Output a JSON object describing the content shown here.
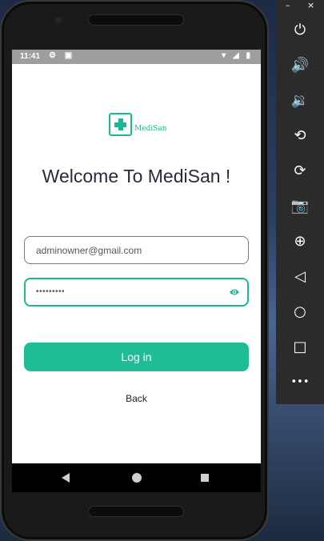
{
  "status_bar": {
    "time": "11:41",
    "left_icons": "⚙ ▣",
    "right_icons": "▾ ◢ ▮"
  },
  "logo": {
    "text": "MediSan",
    "color": "#1ab994"
  },
  "welcome": "Welcome To MediSan !",
  "email": {
    "value": "adminowner@gmail.com"
  },
  "password": {
    "masked_value": "•••••••••"
  },
  "login_button": {
    "label": "Log in",
    "color": "#1ebd96"
  },
  "back_link": "Back",
  "emulator_toolbar": {
    "window_controls": [
      "–",
      "×"
    ],
    "buttons": [
      {
        "name": "power-icon",
        "glyph": "⏻"
      },
      {
        "name": "volume-up-icon",
        "glyph": "🔊"
      },
      {
        "name": "volume-down-icon",
        "glyph": "🔉"
      },
      {
        "name": "rotate-left-icon",
        "glyph": "⟲"
      },
      {
        "name": "rotate-right-icon",
        "glyph": "⟳"
      },
      {
        "name": "camera-icon",
        "glyph": "📷"
      },
      {
        "name": "zoom-icon",
        "glyph": "⊕"
      },
      {
        "name": "back-icon",
        "glyph": "◁"
      },
      {
        "name": "home-icon",
        "glyph": "○"
      },
      {
        "name": "overview-icon",
        "glyph": "□"
      },
      {
        "name": "more-icon",
        "glyph": "•••"
      }
    ]
  }
}
